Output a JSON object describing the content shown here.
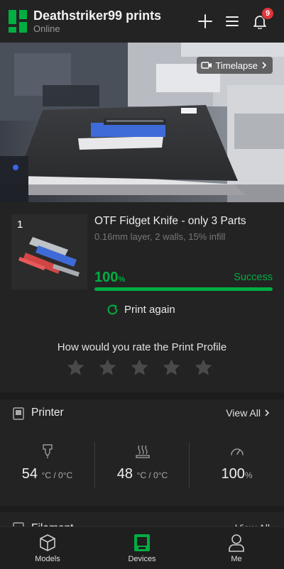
{
  "header": {
    "title": "Deathstriker99 prints",
    "status": "Online",
    "notification_count": "9",
    "icons": [
      "add-icon",
      "menu-icon",
      "bell-icon"
    ]
  },
  "camera": {
    "timelapse_label": "Timelapse"
  },
  "job": {
    "plate_number": "1",
    "name": "OTF Fidget Knife - only 3 Parts",
    "meta": "0.16mm layer, 2 walls, 15% infill",
    "progress_value": "100",
    "progress_unit": "%",
    "progress_fraction": 1.0,
    "status": "Success",
    "print_again_label": "Print again",
    "rating_question": "How would you rate the Print Profile",
    "stars_total": 5,
    "stars_filled": 0
  },
  "printer": {
    "title": "Printer",
    "view_all": "View All",
    "stats": [
      {
        "value": "54",
        "unit": "°C / 0°C",
        "icon": "nozzle-icon"
      },
      {
        "value": "48",
        "unit": "°C / 0°C",
        "icon": "heatbed-icon"
      },
      {
        "value": "100",
        "unit": "%",
        "icon": "speed-gauge-icon"
      }
    ]
  },
  "filament": {
    "title": "Filament",
    "view_all": "View All"
  },
  "nav": {
    "items": [
      {
        "label": "Models",
        "icon": "models-icon"
      },
      {
        "label": "Devices",
        "icon": "devices-icon",
        "active": true
      },
      {
        "label": "Me",
        "icon": "profile-icon"
      }
    ]
  },
  "colors": {
    "accent": "#00ae42",
    "badge": "#e0353b",
    "background": "#1c1c1c",
    "card": "#232323"
  }
}
